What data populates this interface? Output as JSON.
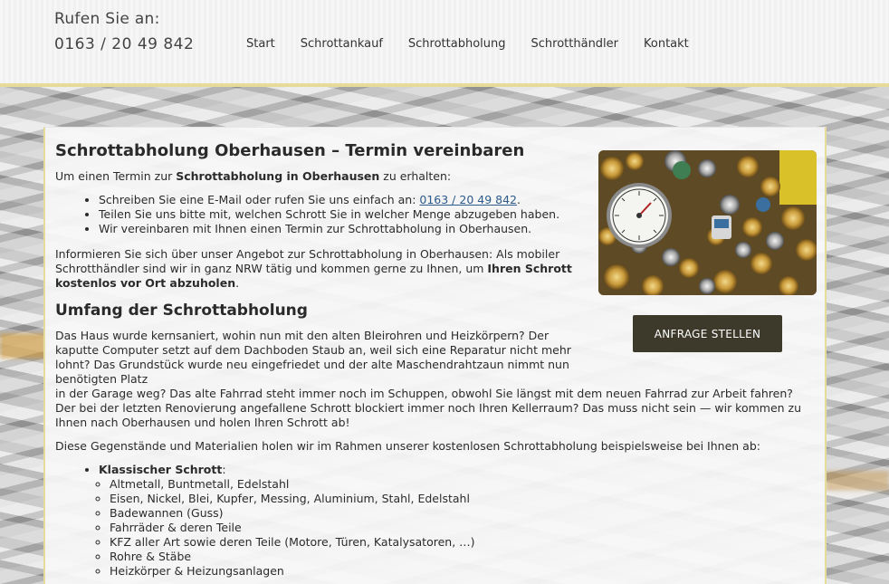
{
  "header": {
    "phone_label": "Rufen Sie an:",
    "phone_number": "0163 / 20 49 842",
    "nav": [
      "Start",
      "Schrottankauf",
      "Schrottabholung",
      "Schrotthändler",
      "Kontakt"
    ]
  },
  "main": {
    "title": "Schrottabholung Oberhausen – Termin vereinbaren",
    "intro_a": "Um einen Termin zur ",
    "intro_b": "Schrottabholung in Oberhausen",
    "intro_c": " zu erhalten:",
    "steps": {
      "s1_a": "Schreiben Sie eine E-Mail oder rufen Sie uns einfach an: ",
      "s1_phone": "0163 / 20 49 842",
      "s1_c": ".",
      "s2": "Teilen Sie uns bitte mit, welchen Schrott Sie in welcher Menge abzugeben haben.",
      "s3": "Wir vereinbaren mit Ihnen einen Termin zur Schrottabholung in Oberhausen."
    },
    "info_a": "Informieren Sie sich über unser Angebot zur Schrottabholung in Oberhausen: Als mobiler Schrotthändler sind wir in ganz NRW tätig und kommen gerne zu Ihnen, um ",
    "info_b": "Ihren Schrott kostenlos vor Ort abzuholen",
    "info_c": ".",
    "section_title": "Umfang der Schrottabholung",
    "section_p1_a": "Das Haus wurde kernsaniert, wohin nun mit den alten Bleirohren und Heizkörpern? Der kaputte Computer setzt auf dem Dachboden Staub an, weil sich eine Reparatur nicht mehr lohnt? Das Grundstück wurde neu eingefriedet und der alte Maschendrahtzaun nimmt nun benötigten Platz",
    "section_p1_b": "in der Garage weg? Das alte Fahrrad steht immer noch im Schuppen, obwohl Sie längst mit dem neuen Fahrrad zur Arbeit fahren? Der bei der letzten Renovierung angefallene Schrott blockiert immer noch Ihren Kellerraum? Das muss nicht sein — wir kommen zu Ihnen nach Oberhausen und holen Ihren Schrott ab!",
    "section_p2": "Diese Gegenstände und Materialien holen wir im Rahmen unserer kostenlosen Schrottabholung beispielsweise bei Ihnen ab:",
    "category_label": "Klassischer Schrott",
    "category_colon": ":",
    "items": [
      "Altmetall, Buntmetall, Edelstahl",
      "Eisen, Nickel, Blei, Kupfer, Messing, Aluminium, Stahl, Edelstahl",
      "Badewannen (Guss)",
      "Fahrräder & deren Teile",
      "KFZ aller Art sowie deren Teile (Motore, Türen, Katalysatoren, …)",
      "Rohre & Stäbe",
      "Heizkörper & Heizungsanlagen"
    ],
    "cta_label": "ANFRAGE STELLEN"
  }
}
